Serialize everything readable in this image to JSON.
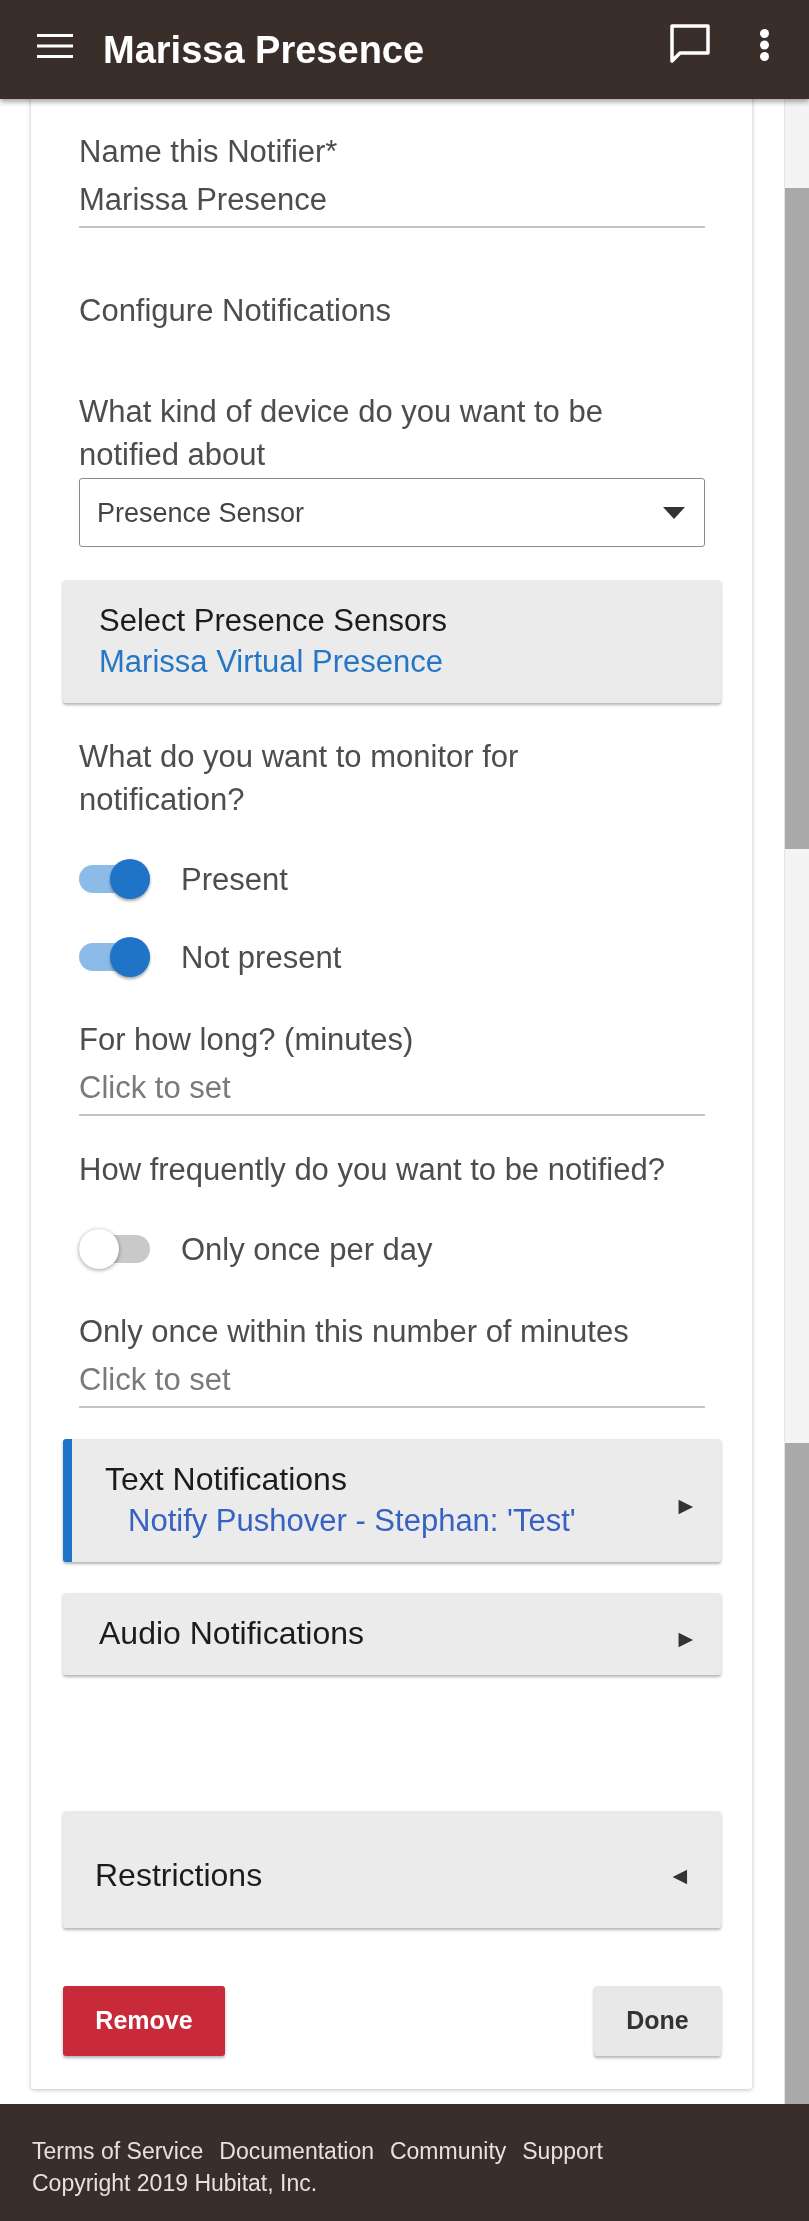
{
  "app_bar": {
    "title": "Marissa Presence"
  },
  "form": {
    "fields": [
      {
        "kind": "input",
        "label": "Name this Notifier*",
        "value": "Marissa Presence"
      },
      {
        "kind": "heading",
        "text": "Configure Notifications"
      },
      {
        "kind": "select",
        "label": "What kind of device do you want to be notified about",
        "value": "Presence Sensor"
      },
      {
        "kind": "picker",
        "title": "Select Presence Sensors",
        "value": "Marissa Virtual Presence"
      },
      {
        "kind": "question",
        "text": "What do you want to monitor for notification?"
      },
      {
        "kind": "switch",
        "label": "Present",
        "on": true
      },
      {
        "kind": "switch",
        "label": "Not present",
        "on": true
      },
      {
        "kind": "input",
        "label": "For how long? (minutes)",
        "placeholder": "Click to set"
      },
      {
        "kind": "question",
        "text": "How frequently do you want to be notified?"
      },
      {
        "kind": "switch",
        "label": "Only once per day",
        "on": false
      },
      {
        "kind": "input",
        "label": "Only once within this number of minutes",
        "placeholder": "Click to set"
      },
      {
        "kind": "section",
        "title": "Text Notifications",
        "summary": "Notify Pushover - Stephan: 'Test'",
        "arrow": "▶",
        "configured": true
      },
      {
        "kind": "section",
        "title": "Audio Notifications",
        "arrow": "▶",
        "configured": false
      }
    ],
    "restrictions": {
      "title": "Restrictions",
      "arrow": "◀"
    },
    "buttons": [
      {
        "label": "Remove",
        "kind": "danger"
      },
      {
        "label": "Done",
        "kind": "default"
      }
    ]
  },
  "footer": {
    "links": [
      "Terms of Service",
      "Documentation",
      "Community",
      "Support"
    ],
    "copyright": "Copyright 2019 Hubitat, Inc."
  }
}
